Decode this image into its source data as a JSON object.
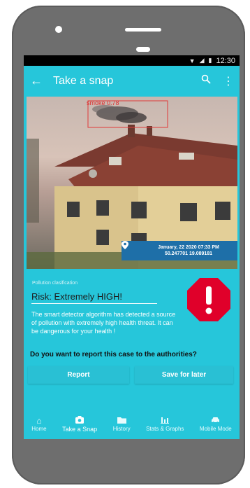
{
  "status_bar": {
    "time": "12:30"
  },
  "app_bar": {
    "title": "Take a snap",
    "back_icon": "arrow-left-icon",
    "actions": [
      "search-icon",
      "more-vert-icon"
    ]
  },
  "photo": {
    "detection_label": "smoke 0.78",
    "geo_date": "January, 22 2020 07:33 PM",
    "geo_coords": "50.247701 19.089181"
  },
  "classification": {
    "label": "Pollution clasification",
    "risk": "Risk: Extremely HIGH!",
    "description": "The smart detector algorithm has detected a source of pollution with extremely high health threat. It can be dangerous for your health !",
    "question": "Do you want to report this case to the authorities?"
  },
  "buttons": {
    "report": "Report",
    "save_later": "Save for later"
  },
  "nav": [
    {
      "label": "Home",
      "icon": "home-icon"
    },
    {
      "label": "Take a Snap",
      "icon": "camera-icon",
      "active": true
    },
    {
      "label": "History",
      "icon": "folder-icon"
    },
    {
      "label": "Stats & Graphs",
      "icon": "bar-chart-icon"
    },
    {
      "label": "Mobile Mode",
      "icon": "car-icon"
    }
  ],
  "colors": {
    "primary": "#26c6da",
    "geo_tag": "#1e6fa8",
    "alert": "#e0002a"
  }
}
